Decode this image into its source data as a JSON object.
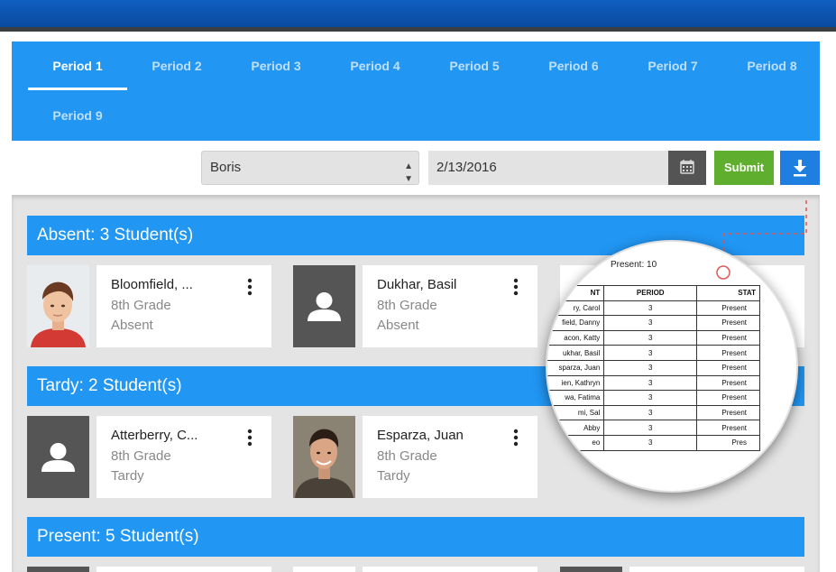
{
  "tabs": [
    {
      "label": "Period 1",
      "active": true
    },
    {
      "label": "Period 2"
    },
    {
      "label": "Period 3"
    },
    {
      "label": "Period 4"
    },
    {
      "label": "Period 5"
    },
    {
      "label": "Period 6"
    },
    {
      "label": "Period 7"
    },
    {
      "label": "Period 8"
    },
    {
      "label": "Period 9"
    }
  ],
  "controls": {
    "teacher": "Boris",
    "date": "2/13/2016",
    "submit_label": "Submit",
    "calendar_icon": "calendar-icon",
    "download_icon": "download-icon"
  },
  "groups": [
    {
      "title": "Absent: 3 Student(s)",
      "students": [
        {
          "name": "Bloomfield, ...",
          "grade": "8th Grade",
          "status": "Absent",
          "photo": "photo"
        },
        {
          "name": "Dukhar, Basil",
          "grade": "8th Grade",
          "status": "Absent",
          "photo": "placeholder"
        }
      ]
    },
    {
      "title": "Tardy: 2 Student(s)",
      "students": [
        {
          "name": "Atterberry, C...",
          "grade": "8th Grade",
          "status": "Tardy",
          "photo": "placeholder"
        },
        {
          "name": "Esparza, Juan",
          "grade": "8th Grade",
          "status": "Tardy",
          "photo": "photo"
        }
      ]
    },
    {
      "title": "Present: 5 Student(s)",
      "students": []
    }
  ],
  "report": {
    "title": "Present: 10",
    "headers": [
      "NT",
      "PERIOD",
      "STAT"
    ],
    "rows": [
      [
        "ry, Carol",
        "3",
        "Present"
      ],
      [
        "field, Danny",
        "3",
        "Present"
      ],
      [
        "acon, Katty",
        "3",
        "Present"
      ],
      [
        "ukhar, Basil",
        "3",
        "Present"
      ],
      [
        "sparza, Juan",
        "3",
        "Present"
      ],
      [
        "ien, Kathryn",
        "3",
        "Present"
      ],
      [
        "wa, Fatima",
        "3",
        "Present"
      ],
      [
        "mi, Sal",
        "3",
        "Present"
      ],
      [
        "Abby",
        "3",
        "Present"
      ],
      [
        "eo",
        "3",
        "Pres"
      ]
    ]
  },
  "colors": {
    "primary": "#2196f3",
    "submit": "#5fae2e",
    "download": "#1f7fe0",
    "header_bar": "#0f5fc2"
  }
}
